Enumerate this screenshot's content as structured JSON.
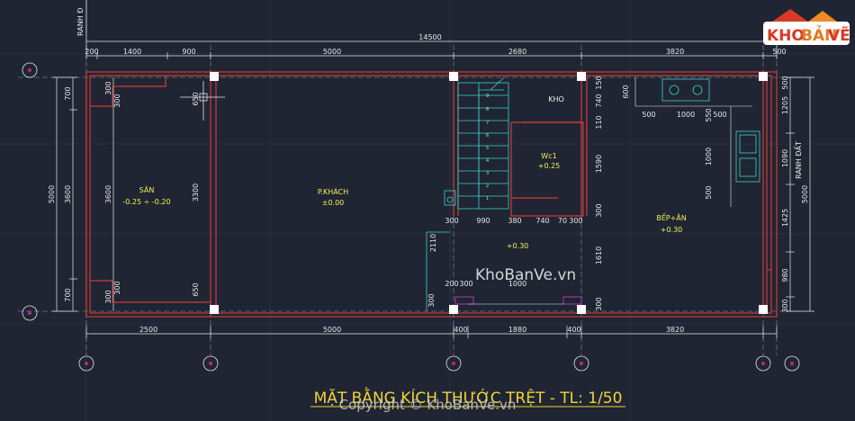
{
  "logo": {
    "part1": "KHO",
    "part2": "BẢN",
    "part3": "VẼ"
  },
  "dims_top": {
    "total": "14500",
    "seg": [
      "200",
      "1400",
      "900",
      "5000",
      "2680",
      "3820",
      "500"
    ]
  },
  "dims_bottom": {
    "seg": [
      "2500",
      "5000",
      "400",
      "1880",
      "400",
      "3820"
    ]
  },
  "dims_left": {
    "outer": "5000",
    "inner": "3600",
    "top": "700",
    "bottom": "700",
    "col_300a": "300",
    "col_300b": "300",
    "col_3600": "3600",
    "col_300c": "300",
    "col_300d": "300"
  },
  "dims_right": {
    "outer": "5000",
    "r1": "1205",
    "r2": "1090",
    "r3": "1425",
    "r4": "980",
    "r5": "300",
    "r6": "500"
  },
  "inner_dims": {
    "d650a": "650",
    "d3300": "3300",
    "d650b": "650",
    "d600": "600",
    "d500a": "500",
    "d1000a": "1000",
    "d500b": "500",
    "d550": "550",
    "d1000b": "1000",
    "d500c": "500",
    "d150": "150",
    "d740a": "740",
    "d110": "110",
    "d1590": "1590",
    "d300a": "300",
    "d1610": "1610",
    "d300b": "300",
    "d2110": "2110",
    "row300": "300",
    "row990": "990",
    "row380": "380",
    "row740": "740",
    "row70": "70",
    "row300b": "300",
    "d200": "200",
    "d300c": "300",
    "d1000c": "1000",
    "d300d": "300"
  },
  "rooms": {
    "san": "SÂN",
    "san_level": "-0.25 ÷ -0.20",
    "pkhach": "P.KHÁCH",
    "pkhach_level": "±0.00",
    "kho": "KHO",
    "wc": "Wc1",
    "wc_level": "+0.25",
    "hall_level": "+0.30",
    "bep": "BẾP+ĂN",
    "bep_level": "+0.30"
  },
  "edge_labels": {
    "left": "RANH Đ",
    "right": "RANH ĐẤT"
  },
  "stair_steps": [
    "9",
    "8",
    "7",
    "6",
    "5",
    "4",
    "3",
    "2",
    "1"
  ],
  "watermark": "KhoBanVe.vn",
  "copyright": "Copyright © KhoBanVe.vn",
  "title": "MẶT BẰNG KÍCH THƯỚC TRỆT - TL: 1/50",
  "colors": {
    "wall": "#d23a3a",
    "dim": "#e8e8e8",
    "label": "#f2f25a",
    "stair": "#3fd0c8",
    "grid": "#5a6a7a"
  }
}
